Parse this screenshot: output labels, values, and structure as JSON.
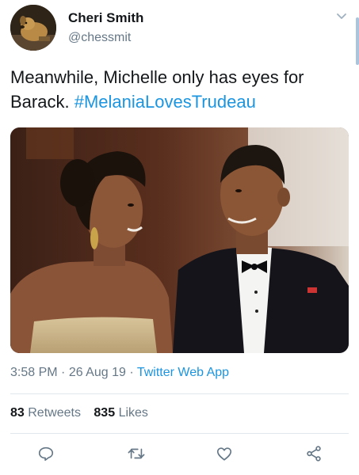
{
  "user": {
    "display_name": "Cheri Smith",
    "handle": "@chessmit",
    "avatar_icon": "dog-avatar"
  },
  "tweet": {
    "text": "Meanwhile, Michelle only has eyes for Barack. ",
    "hashtag": "#MelaniaLovesTrudeau"
  },
  "meta": {
    "time": "3:58 PM",
    "separator": " · ",
    "date": "26 Aug 19",
    "source": "Twitter Web App"
  },
  "stats": {
    "retweets_count": "83",
    "retweets_label": "Retweets",
    "likes_count": "835",
    "likes_label": "Likes"
  },
  "actions": {
    "reply_icon": "comment-icon",
    "retweet_icon": "retweet-icon",
    "like_icon": "heart-icon",
    "share_icon": "share-icon"
  },
  "colors": {
    "link": "#1b95e0",
    "secondary_text": "#657786",
    "primary_text": "#14171a",
    "divider": "#e1e8ed"
  }
}
